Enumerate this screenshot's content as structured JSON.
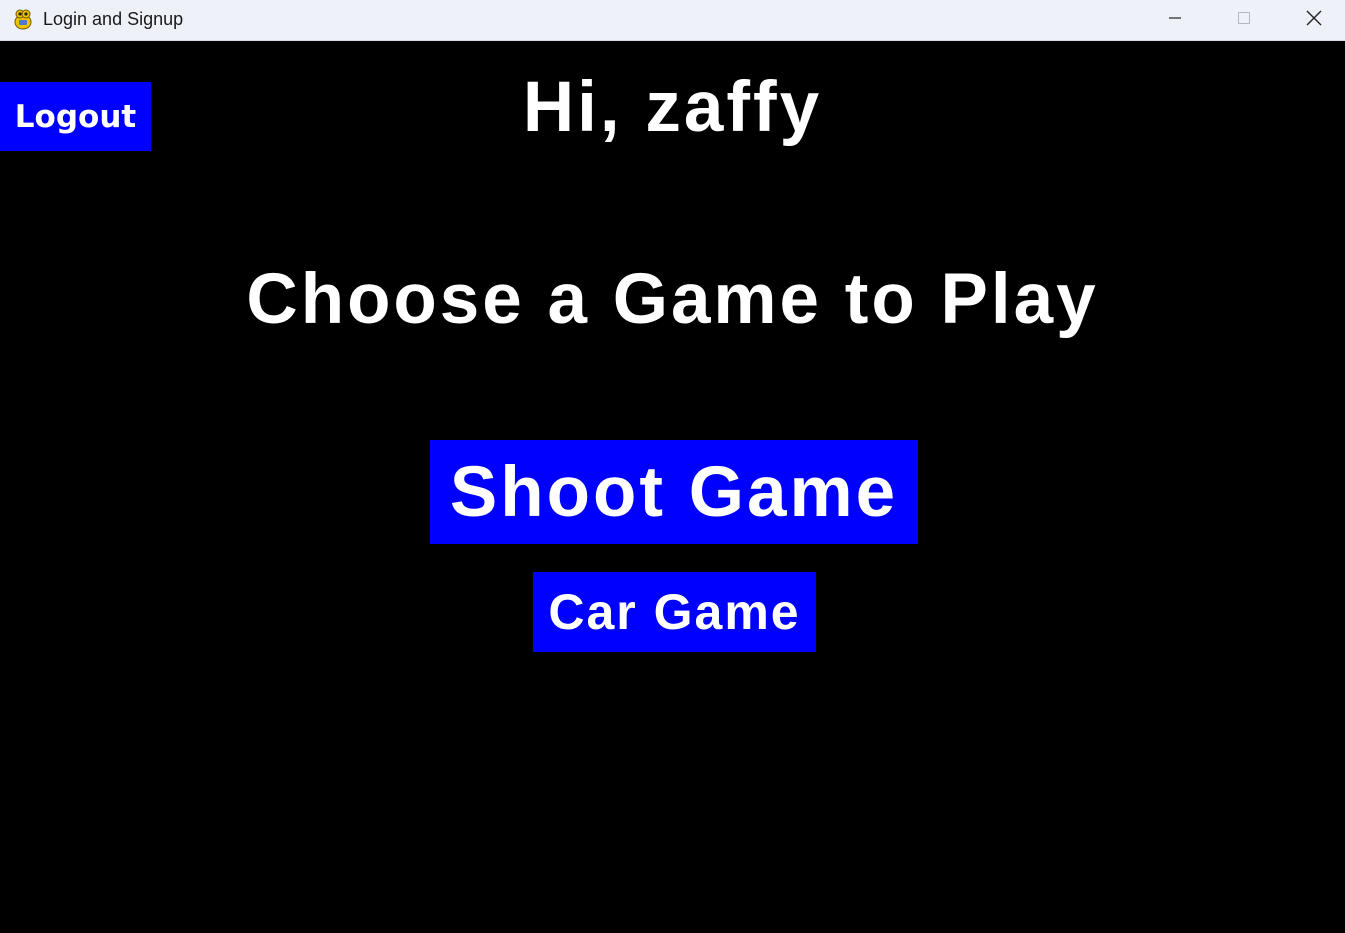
{
  "window": {
    "title": "Login and Signup",
    "icon": "pygame-snake-icon",
    "controls": {
      "minimize": "minimize-icon",
      "maximize": "maximize-icon",
      "close": "close-icon"
    }
  },
  "main": {
    "logout_label": "Logout",
    "greeting": "Hi, zaffy",
    "heading": "Choose a Game to Play",
    "games": [
      {
        "label": "Shoot Game"
      },
      {
        "label": "Car Game"
      }
    ]
  },
  "colors": {
    "background": "#000000",
    "button": "#0000fe",
    "text": "#ffffff",
    "titlebar": "#eef1f8"
  }
}
